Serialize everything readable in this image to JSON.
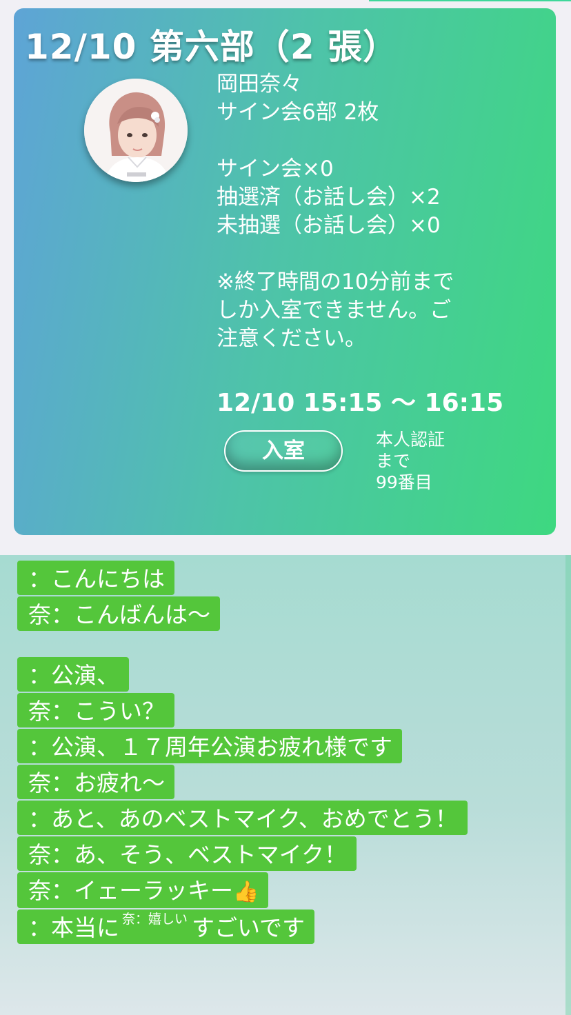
{
  "card": {
    "title": "12/10 第六部（2 張）",
    "member_name": "岡田奈々",
    "session": "サイン会6部 2枚",
    "sign_count": "サイン会×0",
    "drawn": "抽選済（お話し会）×2",
    "undrawn": "未抽選（お話し会）×0",
    "note_lines": [
      "※終了時間の10分前まで",
      "しか入室できません。ご",
      "注意ください。"
    ],
    "time": "12/10 15:15 〜 16:15",
    "enter_label": "入室",
    "queue_lines": [
      "本人認証",
      "まで",
      "99番目"
    ]
  },
  "chat": {
    "group1": [
      "：こんにちは",
      "奈：こんばんは〜"
    ],
    "group2": [
      "：公演、",
      "奈：こうい？",
      "：公演、１７周年公演お疲れ様です",
      "奈：お疲れ〜",
      "：あと、あのベストマイク、おめでとう！",
      "奈：あ、そう、ベストマイク！",
      "奈：イェーラッキー"
    ],
    "last_before": "：本当に",
    "last_ruby": "奈：嬉しい",
    "last_after": "すごいです",
    "thumb_emoji": "👍"
  },
  "colors": {
    "card_gradient_start": "#5ea4d6",
    "card_gradient_end": "#3ed880",
    "bubble": "#54c63b",
    "chat_bg_top": "#a6dbd1"
  },
  "icons": {
    "thumb": "thumbs-up-emoji"
  }
}
